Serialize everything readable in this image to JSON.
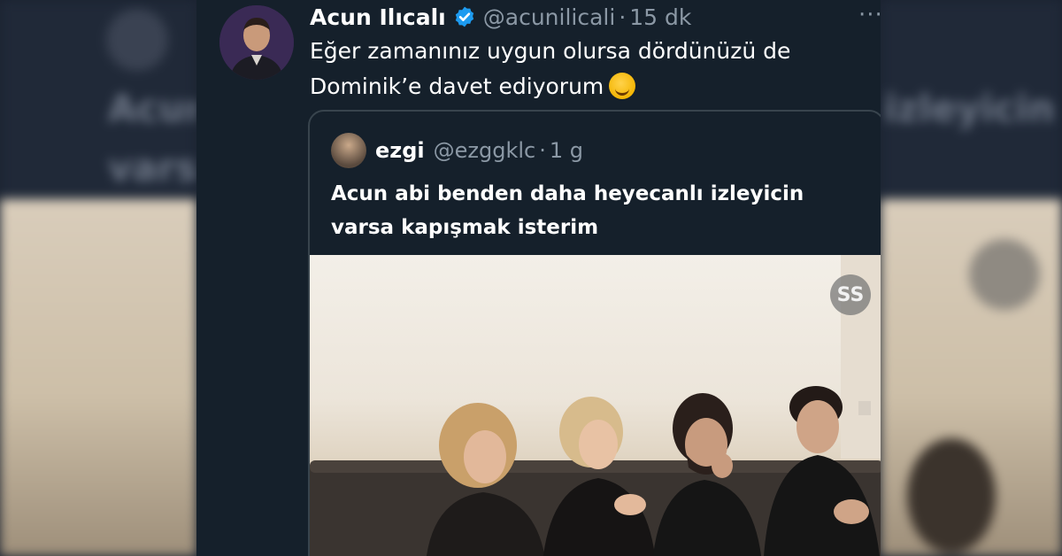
{
  "tweet": {
    "author_name": "Acun Ilıcalı",
    "handle": "@acunilicali",
    "separator": "·",
    "time": "15 dk",
    "more_menu": "···",
    "text_line1": "Eğer zamanınız uygun olursa dördünüzü de",
    "text_line2": "Dominik’e davet ediyorum"
  },
  "quoted_tweet": {
    "author_name": "ezgi",
    "handle": "@ezggklc",
    "separator": "·",
    "time": "1 g",
    "text_line1": "Acun abi benden daha heyecanlı izleyicin",
    "text_line2": "varsa kapışmak isterim"
  },
  "media": {
    "watermark_label": "SS"
  },
  "icons": {
    "verified": "verified-badge-icon",
    "more": "more-options-icon",
    "emoji": "smiling-face-emoji-icon"
  },
  "colors": {
    "background": "#15202b",
    "text_primary": "#ffffff",
    "text_secondary": "#8b98a5",
    "verified_blue": "#1d9bf0",
    "border": "#38444d"
  }
}
